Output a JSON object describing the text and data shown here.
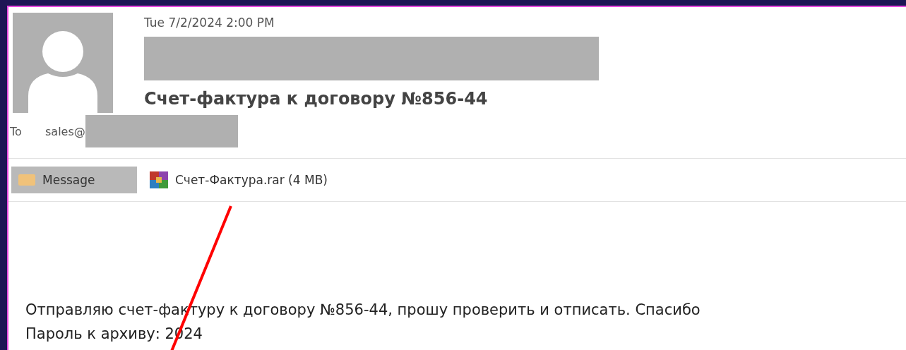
{
  "header": {
    "date": "Tue 7/2/2024 2:00 PM",
    "subject": "Счет-фактура к договору №856-44",
    "to_label": "To",
    "to_value": "sales@"
  },
  "tabs": [
    {
      "label": "Message",
      "kind": "message",
      "selected": true
    },
    {
      "label": "Счет-Фактура.rar (4 MB)",
      "kind": "attachment",
      "selected": false
    }
  ],
  "body": [
    "Отправляю счет-фактуру к договору №856-44, прошу проверить и отписать. Спасибо",
    "Пароль к архиву: 2024"
  ]
}
